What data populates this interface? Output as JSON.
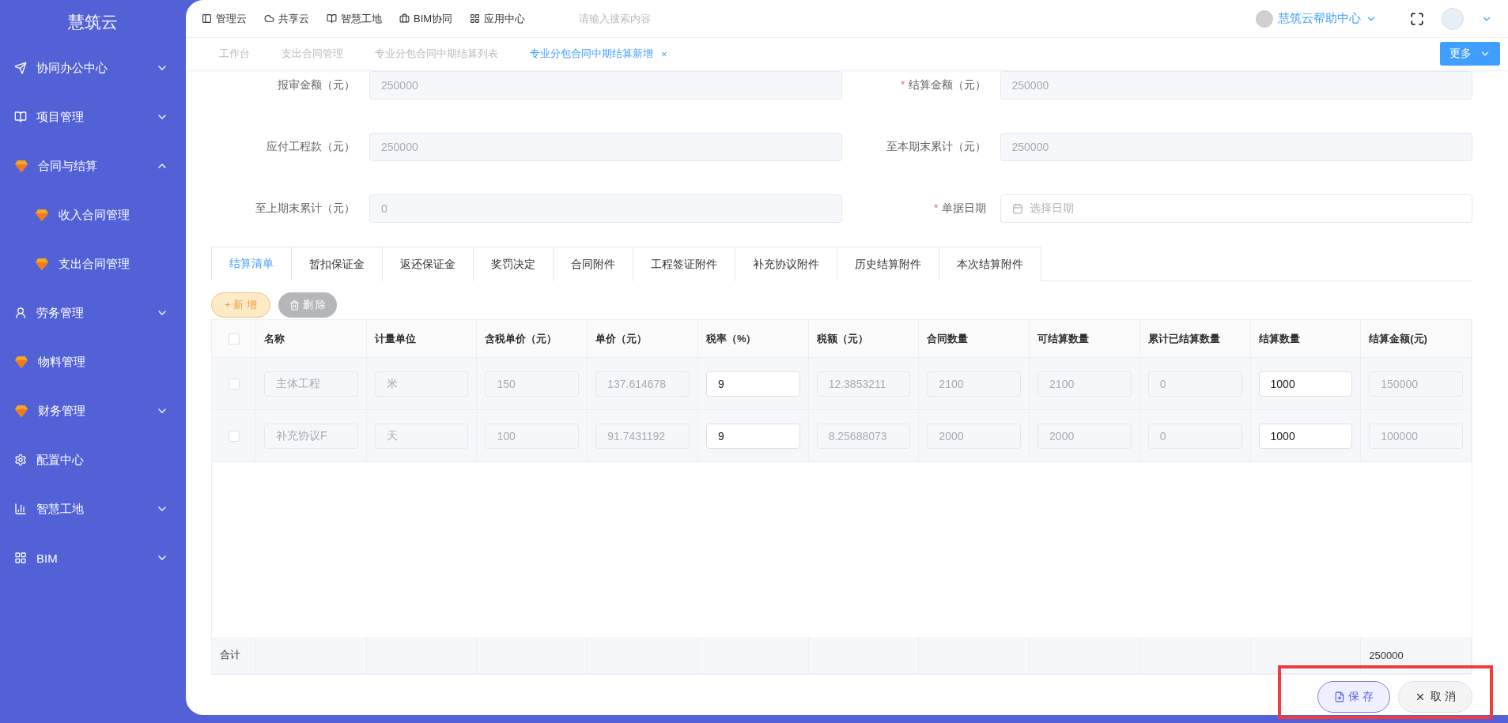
{
  "sidebar": {
    "title": "慧筑云",
    "items": [
      {
        "label": "协同办公中心",
        "expanded": false
      },
      {
        "label": "项目管理",
        "expanded": false
      },
      {
        "label": "合同与结算",
        "expanded": true,
        "children": [
          {
            "label": "收入合同管理"
          },
          {
            "label": "支出合同管理"
          }
        ]
      },
      {
        "label": "劳务管理",
        "expanded": false
      },
      {
        "label": "物料管理"
      },
      {
        "label": "财务管理",
        "expanded": false
      },
      {
        "label": "配置中心"
      },
      {
        "label": "智慧工地",
        "expanded": false
      },
      {
        "label": "BIM",
        "expanded": false
      }
    ]
  },
  "top_nav": [
    "管理云",
    "共享云",
    "智慧工地",
    "BIM协同",
    "应用中心"
  ],
  "search": {
    "placeholder": "请输入搜索内容"
  },
  "help": "慧筑云帮助中心",
  "page_tabs": [
    {
      "label": "工作台",
      "selected": false
    },
    {
      "label": "支出合同管理",
      "selected": false
    },
    {
      "label": "专业分包合同中期结算列表",
      "selected": false
    },
    {
      "label": "专业分包合同中期结算新增",
      "selected": true,
      "close": "×"
    }
  ],
  "more_button": "更多",
  "form": [
    {
      "label": "报审金额（元）",
      "value": "250000"
    },
    {
      "label": "结算金额（元）",
      "required_mark": "*",
      "value": "250000"
    },
    {
      "label": "应付工程款（元）",
      "value": "250000"
    },
    {
      "label": "至本期末累计（元）",
      "value": "250000"
    },
    {
      "label": "至上期末累计（元）",
      "value": "0"
    },
    {
      "label": "单据日期",
      "required_mark": "*",
      "kind": "date",
      "placeholder": "选择日期"
    }
  ],
  "detail_tabs": [
    {
      "label": "结算清单",
      "selected": true
    },
    {
      "label": "暂扣保证金",
      "selected": false
    },
    {
      "label": "返还保证金",
      "selected": false
    },
    {
      "label": "奖罚决定",
      "selected": false
    },
    {
      "label": "合同附件",
      "selected": false
    },
    {
      "label": "工程签证附件",
      "selected": false
    },
    {
      "label": "补充协议附件",
      "selected": false
    },
    {
      "label": "历史结算附件",
      "selected": false
    },
    {
      "label": "本次结算附件",
      "selected": false
    }
  ],
  "toolbar": {
    "add": "+ 新 增",
    "delete": "删 除"
  },
  "table": {
    "select_all": {
      "checked": false
    },
    "columns": [
      "名称",
      "计量单位",
      "含税单价（元）",
      "单价（元）",
      "税率（%）",
      "税额（元）",
      "合同数量",
      "可结算数量",
      "累计已结算数量",
      "结算数量",
      "结算金额(元)"
    ],
    "rows": [
      {
        "checked": false,
        "cells": [
          {
            "value": "主体工程",
            "disabled": true
          },
          {
            "value": "米",
            "disabled": true
          },
          {
            "value": "150",
            "disabled": true
          },
          {
            "value": "137.614678",
            "disabled": true
          },
          {
            "value": "9",
            "disabled": false
          },
          {
            "value": "12.3853211",
            "disabled": true
          },
          {
            "value": "2100",
            "disabled": true
          },
          {
            "value": "2100",
            "disabled": true
          },
          {
            "value": "0",
            "disabled": true
          },
          {
            "value": "1000",
            "disabled": false
          },
          {
            "value": "150000",
            "disabled": true
          }
        ]
      },
      {
        "checked": false,
        "cells": [
          {
            "value": "补充协议F",
            "disabled": true
          },
          {
            "value": "天",
            "disabled": true
          },
          {
            "value": "100",
            "disabled": true
          },
          {
            "value": "91.7431192",
            "disabled": true
          },
          {
            "value": "9",
            "disabled": false
          },
          {
            "value": "8.25688073",
            "disabled": true
          },
          {
            "value": "2000",
            "disabled": true
          },
          {
            "value": "2000",
            "disabled": true
          },
          {
            "value": "0",
            "disabled": true
          },
          {
            "value": "1000",
            "disabled": false
          },
          {
            "value": "100000",
            "disabled": true
          }
        ]
      }
    ],
    "summary": {
      "label": "合计",
      "total": "250000"
    }
  },
  "actions": {
    "save": "保 存",
    "cancel": "取 消"
  }
}
